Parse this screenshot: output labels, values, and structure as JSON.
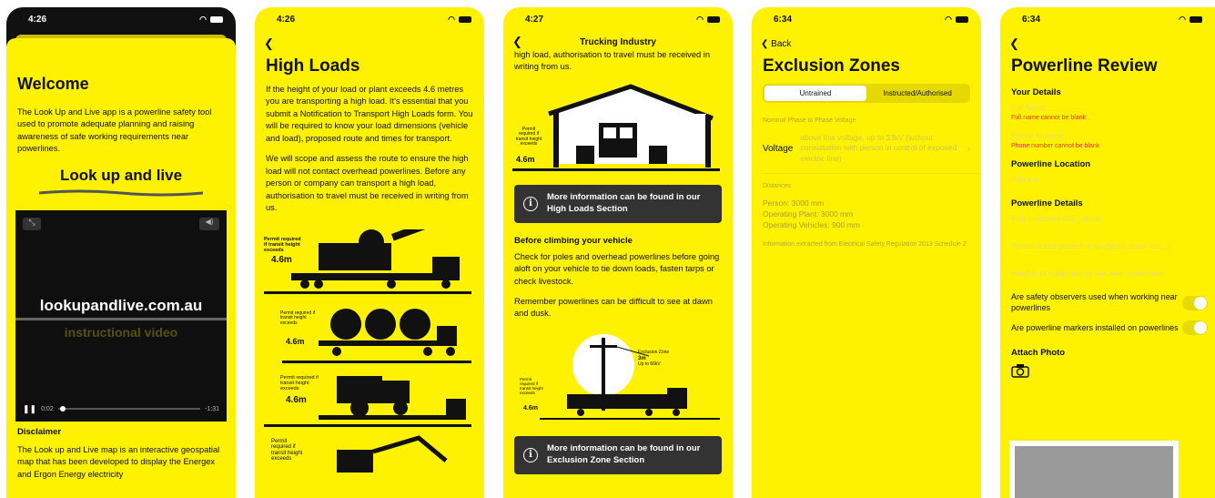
{
  "screens": [
    {
      "time": "4:26",
      "welcome": "Welcome",
      "intro": "The Look Up and Live app is a powerline safety tool used to promote adequate planning and raising awareness of safe working requirements near powerlines.",
      "logo_text": "Look up and live",
      "video": {
        "url_text": "lookupandlive.com.au",
        "subtitle": "instructional video",
        "time_elapsed": "0:02",
        "time_remaining": "-1:31"
      },
      "disclaimer": "Disclaimer",
      "disclaimer_text": "The Look up and Live map is an interactive geospatial map that has been developed to display the Energex and Ergon Energy electricity"
    },
    {
      "time": "4:26",
      "title": "High Loads",
      "para1": "If the height of your load or plant exceeds 4.6 metres you are transporting a high load. It's essential that you submit a Notification to Transport High Loads form. You will be required to know your load dimensions (vehicle and load), proposed route and times for transport.",
      "para2": "We will scope and assess the route to ensure the high load will not contact overhead powerlines. Before any person or company can transport a high load, authorisation to travel must be received in writing from us.",
      "permit_label": "Permit required if transit height exceeds",
      "height": "4.6m"
    },
    {
      "time": "4:27",
      "nav_title": "Trucking Industry",
      "top_text": "high load, authorisation to travel must be received in writing from us.",
      "permit_label": "Permit required if transit height exceeds",
      "height": "4.6m",
      "info1": "More information can be found in our High Loads Section",
      "subheading": "Before climbing your vehicle",
      "para1": "Check for poles and overhead powerlines before going aloft on your vehicle to tie down loads, fasten tarps or check livestock.",
      "para2": "Remember powerlines can be difficult to see at dawn and dusk.",
      "zone_label": "Exclusion Zone",
      "zone_dist": "3m",
      "zone_volt": "Up to 66kV",
      "info2": "More information can be found in our Exclusion Zone Section"
    },
    {
      "time": "6:34",
      "back_label": "Back",
      "title": "Exclusion Zones",
      "seg_untrained": "Untrained",
      "seg_authorised": "Instructed/Authorised",
      "phase_label": "Nominal Phase to Phase Voltage",
      "voltage_label": "Voltage",
      "voltage_value": "above low voltage, up to 33kV (without consultation with person in control of exposed electric line)",
      "distances_label": "Distances",
      "distances": [
        "Person: 3000 mm",
        "Operating Plant: 3000 mm",
        "Operating Vehicles: 900 mm"
      ],
      "source_note": "Information extracted from Electrical Safety Regulation 2013 Schedule 2"
    },
    {
      "time": "6:34",
      "title": "Powerline Review",
      "your_details": "Your Details",
      "full_name_ph": "Full Name",
      "full_name_err": "Full name cannot be blank",
      "phone_ph": "Phone Number",
      "phone_err": "Phone number cannot be blank",
      "location_label": "Powerline Location",
      "address_ph": "Address",
      "details_label": "Powerline Details",
      "pole_ph": "Pole Numbers/Site Labels",
      "terrain_ph": "Terrain under powerline (paddock, road, etc...)",
      "heights_ph": "Heights of equipment in use near powerlines",
      "q_observers": "Are safety observers used when working near powerlines",
      "q_markers": "Are powerline markers installed on powerlines",
      "attach": "Attach Photo"
    }
  ]
}
